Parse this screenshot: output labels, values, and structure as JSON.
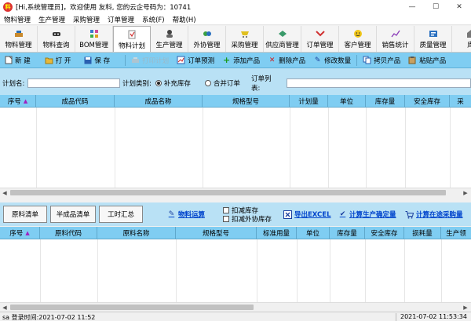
{
  "window": {
    "title": "[Hi,系统管理员]，欢迎使用 友料, 您的云企号码为：10741",
    "app_icon_text": "料",
    "minimize": "—",
    "maximize": "☐",
    "close": "✕"
  },
  "menu": [
    "物料管理",
    "生产管理",
    "采购管理",
    "订单管理",
    "系统(F)",
    "帮助(H)"
  ],
  "modules": [
    {
      "label": "物料管理",
      "icon": "material-icon"
    },
    {
      "label": "物料查询",
      "icon": "gamepad-icon"
    },
    {
      "label": "BOM管理",
      "icon": "bom-icon"
    },
    {
      "label": "物料计划",
      "icon": "plan-icon"
    },
    {
      "label": "生产管理",
      "icon": "worker-icon"
    },
    {
      "label": "外协管理",
      "icon": "outsource-icon"
    },
    {
      "label": "采购管理",
      "icon": "purchase-icon"
    },
    {
      "label": "供应商管理",
      "icon": "supplier-icon"
    },
    {
      "label": "订单管理",
      "icon": "order-icon"
    },
    {
      "label": "客户管理",
      "icon": "customer-icon"
    },
    {
      "label": "销售统计",
      "icon": "sales-chart-icon"
    },
    {
      "label": "质量管理",
      "icon": "quality-icon"
    },
    {
      "label": "库",
      "icon": "warehouse-icon"
    }
  ],
  "active_module": "物料计划",
  "toolbar": {
    "new": "新 建",
    "open": "打 开",
    "save": "保 存",
    "print": "打印计划",
    "forecast": "订单预测",
    "add_product": "添加产品",
    "delete_product": "删除产品",
    "edit_qty": "修改数量",
    "copy_product": "拷贝产品",
    "paste_product": "粘贴产品"
  },
  "filter": {
    "plan_name_label": "计划名:",
    "plan_name_value": "",
    "plan_type_label": "计划类别:",
    "radio_restock": "补充库存",
    "radio_merge": "合并订单",
    "radio_selected": "补充库存",
    "order_list_label": "订单列表:",
    "order_list_value": ""
  },
  "top_grid": {
    "columns": [
      "序号",
      "成品代码",
      "成品名称",
      "规格型号",
      "计划量",
      "单位",
      "库存量",
      "安全库存",
      "采"
    ]
  },
  "mid": {
    "btn_materials": "原料清单",
    "btn_semi": "半成品清单",
    "btn_hours": "工时汇总",
    "calc_materials": "物料运算",
    "cb_deduct_stock": "扣减库存",
    "cb_deduct_outsource": "扣减外协库存",
    "export_excel": "导出EXCEL",
    "calc_production": "计算生产确定量",
    "calc_transit": "计算在途采购量"
  },
  "bottom_grid": {
    "columns": [
      "序号",
      "原料代码",
      "原料名称",
      "规格型号",
      "标准用量",
      "单位",
      "库存量",
      "安全库存",
      "损耗量",
      "生产领"
    ]
  },
  "status": {
    "left": "sa 登录时间:2021-07-02 11:52",
    "right": "2021-07-02 11:53:34"
  },
  "colors": {
    "toolbar_bg": "#7fcdf2",
    "panel_bg": "#b9e1f5",
    "link": "#0044cc",
    "sort_indicator": "#a020c0"
  }
}
